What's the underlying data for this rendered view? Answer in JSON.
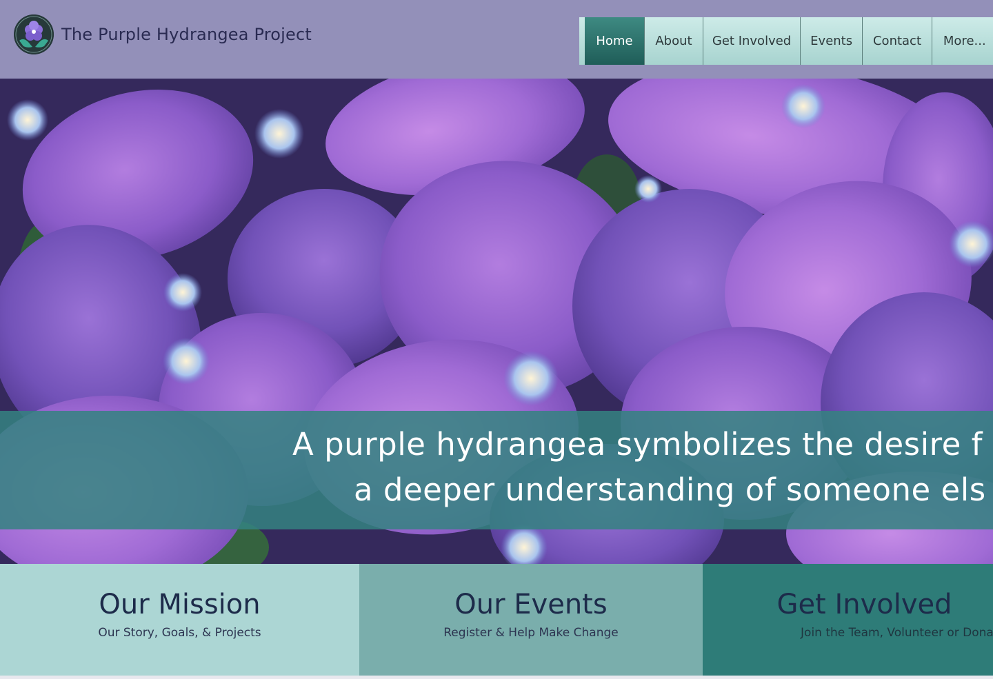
{
  "header": {
    "site_title": "The Purple Hydrangea Project",
    "logo_icon": "hydrangea-hands-logo"
  },
  "nav": {
    "items": [
      {
        "label": "Home",
        "active": true
      },
      {
        "label": "About",
        "active": false
      },
      {
        "label": "Get Involved",
        "active": false
      },
      {
        "label": "Events",
        "active": false
      },
      {
        "label": "Contact",
        "active": false
      },
      {
        "label": "More...",
        "active": false
      }
    ]
  },
  "hero": {
    "image": "purple-hydrangea-flowers-photo",
    "quote_line1": "A purple hydrangea symbolizes the desire f",
    "quote_line2": "a deeper understanding of someone els"
  },
  "panels": [
    {
      "title": "Our Mission",
      "subtitle": "Our Story, Goals, & Projects"
    },
    {
      "title": "Our Events",
      "subtitle": "Register & Help Make Change"
    },
    {
      "title": "Get Involved",
      "subtitle": "Join the Team, Volunteer or Donate"
    }
  ],
  "colors": {
    "header_bg": "#9390b9",
    "nav_bg": "#a7d3cf",
    "nav_active": "#1f5d58",
    "banner": "#348280",
    "panel_1": "#acd6d4",
    "panel_2": "#7aaeac",
    "panel_3": "#2e7c78",
    "text_dark": "#1d2b4a"
  }
}
